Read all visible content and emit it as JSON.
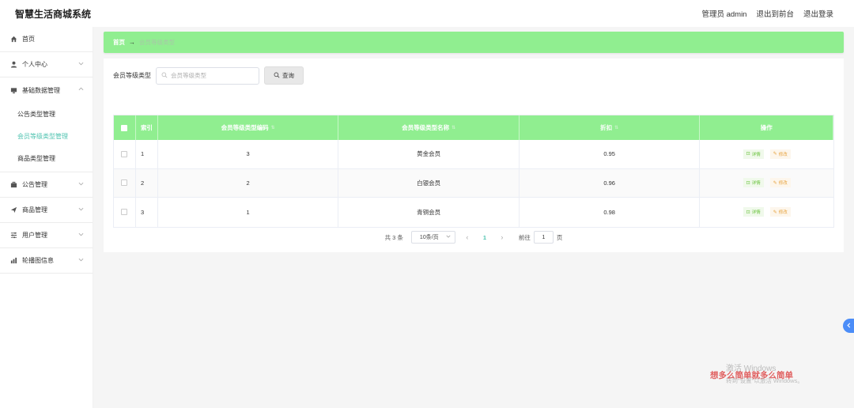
{
  "app": {
    "title": "智慧生活商城系统"
  },
  "header": {
    "admin": "管理员 admin",
    "to_front": "退出到前台",
    "logout": "退出登录"
  },
  "sidebar": {
    "items": [
      {
        "label": "首页",
        "icon": "home-icon"
      },
      {
        "label": "个人中心",
        "icon": "user-icon"
      },
      {
        "label": "基础数据管理",
        "icon": "monitor-icon"
      },
      {
        "label": "公告管理",
        "icon": "briefcase-icon"
      },
      {
        "label": "商品管理",
        "icon": "send-icon"
      },
      {
        "label": "用户管理",
        "icon": "sliders-icon"
      },
      {
        "label": "轮播图信息",
        "icon": "bar-chart-icon"
      }
    ],
    "sub_items": [
      {
        "label": "公告类型管理"
      },
      {
        "label": "会员等级类型管理"
      },
      {
        "label": "商品类型管理"
      }
    ]
  },
  "breadcrumb": {
    "home": "首页",
    "current": "会员等级类型"
  },
  "search": {
    "label": "会员等级类型",
    "placeholder": "会员等级类型",
    "button": "查询"
  },
  "table": {
    "columns": [
      "索引",
      "会员等级类型编码",
      "会员等级类型名称",
      "折扣",
      "操作"
    ],
    "rows": [
      {
        "index": "1",
        "code": "3",
        "name": "黄金会员",
        "discount": "0.95"
      },
      {
        "index": "2",
        "code": "2",
        "name": "白银会员",
        "discount": "0.96"
      },
      {
        "index": "3",
        "code": "1",
        "name": "青铜会员",
        "discount": "0.98"
      }
    ],
    "op_detail": "详情",
    "op_edit": "修改"
  },
  "pager": {
    "total": "共 3 条",
    "size": "10条/页",
    "page": "1",
    "goto": "前往",
    "goto_value": "1",
    "page_unit": "页"
  },
  "watermark": {
    "red": "想多么简单就多么简单",
    "line1": "激活 Windows",
    "line2": "转到\"设置\"以激活 Windows。"
  },
  "colors": {
    "accent": "#90ee90",
    "active_text": "#4fc3b0",
    "detail": "#67c23a",
    "edit": "#e6a23c",
    "side_tab": "#4b8df8"
  }
}
